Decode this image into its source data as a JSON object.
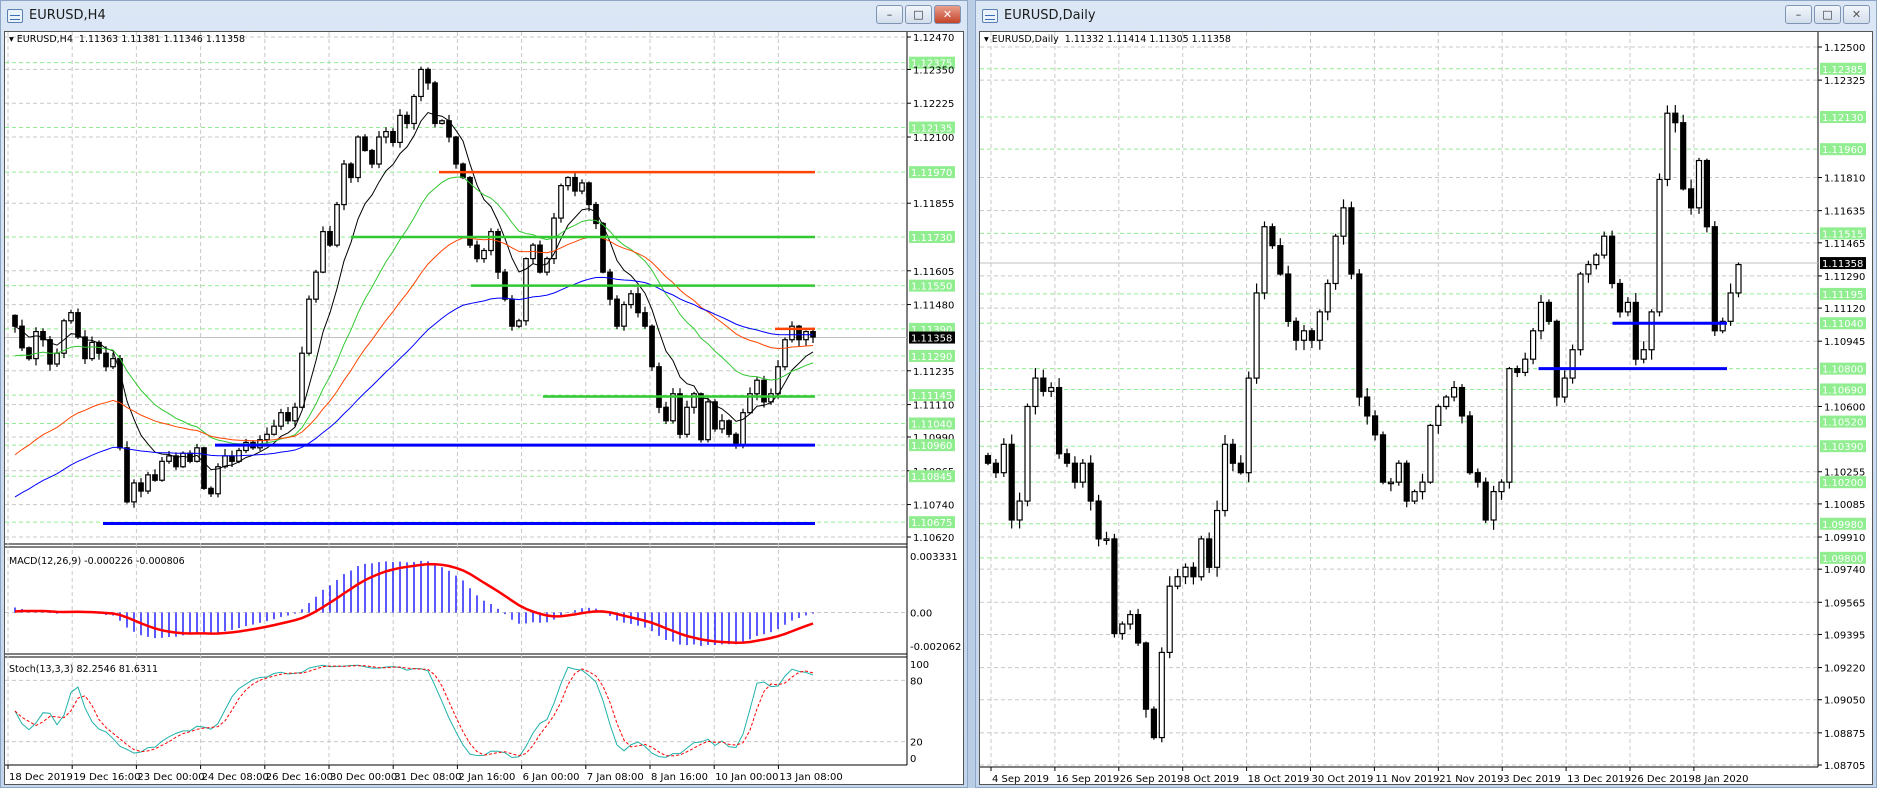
{
  "left_window": {
    "title": "EURUSD,H4",
    "info": "EURUSD,H4  1.11363 1.11381 1.11346 1.11358",
    "macd_label": "MACD(12,26,9) -0.000226 -0.000806",
    "stoch_label": "Stoch(13,3,3) 82.2546 81.6311",
    "buttons": {
      "minimize": "–",
      "maximize": "□",
      "close": "✕"
    }
  },
  "right_window": {
    "title": "EURUSD,Daily",
    "info": "EURUSD,Daily  1.11332 1.11414 1.11305 1.11358",
    "buttons": {
      "minimize": "–",
      "maximize": "□",
      "close": "✕"
    }
  },
  "colors": {
    "bull": "#ffffff",
    "bear": "#000000",
    "level_green": "#32c832",
    "level_orange": "#ff4500",
    "level_blue": "#0000ff",
    "label_green": "#90ee90",
    "macd_hist": "#0000ff",
    "macd_signal": "#ff0000",
    "stoch_main": "#20b2aa",
    "stoch_signal": "#ff0000"
  },
  "chart_data": [
    {
      "type": "candlestick",
      "title": "EURUSD,H4",
      "ylim": [
        1.1062,
        1.1247
      ],
      "x_tick_labels": [
        "18 Dec 2019",
        "19 Dec 16:00",
        "23 Dec 00:00",
        "24 Dec 08:00",
        "26 Dec 16:00",
        "30 Dec 00:00",
        "31 Dec 08:00",
        "2 Jan 16:00",
        "6 Jan 00:00",
        "7 Jan 08:00",
        "8 Jan 16:00",
        "10 Jan 00:00",
        "13 Jan 08:00"
      ],
      "closes": [
        1.114,
        1.1132,
        1.1128,
        1.1138,
        1.1135,
        1.1126,
        1.113,
        1.1142,
        1.1145,
        1.1136,
        1.1128,
        1.1134,
        1.113,
        1.1125,
        1.1128,
        1.1095,
        1.1075,
        1.1082,
        1.1079,
        1.1085,
        1.1083,
        1.109,
        1.1092,
        1.1088,
        1.1093,
        1.109,
        1.1095,
        1.108,
        1.1078,
        1.1088,
        1.1092,
        1.109,
        1.1094,
        1.1097,
        1.1095,
        1.1098,
        1.11,
        1.1103,
        1.1108,
        1.1105,
        1.111,
        1.113,
        1.115,
        1.116,
        1.1175,
        1.117,
        1.1185,
        1.12,
        1.1195,
        1.121,
        1.1205,
        1.12,
        1.121,
        1.1212,
        1.1208,
        1.1218,
        1.1215,
        1.1225,
        1.1235,
        1.123,
        1.1215,
        1.1216,
        1.121,
        1.12,
        1.1195,
        1.117,
        1.1165,
        1.1168,
        1.1175,
        1.116,
        1.115,
        1.114,
        1.1142,
        1.1165,
        1.117,
        1.116,
        1.1165,
        1.118,
        1.1192,
        1.1195,
        1.119,
        1.1193,
        1.1185,
        1.1178,
        1.116,
        1.115,
        1.114,
        1.1148,
        1.1152,
        1.1145,
        1.114,
        1.1125,
        1.111,
        1.1105,
        1.1115,
        1.11,
        1.111,
        1.1115,
        1.1098,
        1.1112,
        1.1102,
        1.1105,
        1.11,
        1.1096,
        1.1108,
        1.1115,
        1.112,
        1.1112,
        1.1115,
        1.1125,
        1.1135,
        1.114,
        1.1135,
        1.1138,
        1.1136
      ],
      "moving_averages": [
        {
          "color": "#000000",
          "period": 8,
          "start": 1.114
        },
        {
          "color": "#32c832",
          "period": 22,
          "start": 1.1128
        },
        {
          "color": "#ff4500",
          "period": 40,
          "start": 1.109
        },
        {
          "color": "#0000ff",
          "period": 70,
          "start": 1.1075
        }
      ],
      "levels": [
        {
          "price": 1.1197,
          "color": "orange",
          "from": 0.53
        },
        {
          "price": 1.1173,
          "color": "green",
          "from": 0.42
        },
        {
          "price": 1.1155,
          "color": "green",
          "from": 0.57
        },
        {
          "price": 1.1139,
          "color": "orange",
          "from": 0.95
        },
        {
          "price": 1.1114,
          "color": "green",
          "from": 0.66
        },
        {
          "price": 1.1096,
          "color": "blue",
          "from": 0.25
        },
        {
          "price": 1.1067,
          "color": "blue",
          "from": 0.11
        }
      ],
      "axis_labels": [
        {
          "v": 1.1247,
          "t": "1.12470"
        },
        {
          "v": 1.12375,
          "t": "1.12375",
          "g": 1
        },
        {
          "v": 1.1235,
          "t": "1.12350"
        },
        {
          "v": 1.12225,
          "t": "1.12225"
        },
        {
          "v": 1.12135,
          "t": "1.12135",
          "g": 1
        },
        {
          "v": 1.121,
          "t": "1.12100"
        },
        {
          "v": 1.1197,
          "t": "1.11970",
          "g": 1
        },
        {
          "v": 1.11855,
          "t": "1.11855"
        },
        {
          "v": 1.1173,
          "t": "1.11730",
          "g": 1
        },
        {
          "v": 1.11605,
          "t": "1.11605"
        },
        {
          "v": 1.1155,
          "t": "1.11550",
          "g": 1
        },
        {
          "v": 1.1148,
          "t": "1.11480"
        },
        {
          "v": 1.1139,
          "t": "1.11390",
          "g": 1
        },
        {
          "v": 1.11358,
          "t": "1.11358",
          "cur": 1
        },
        {
          "v": 1.1129,
          "t": "1.11290",
          "g": 1
        },
        {
          "v": 1.11235,
          "t": "1.11235"
        },
        {
          "v": 1.11145,
          "t": "1.11145",
          "g": 1
        },
        {
          "v": 1.1111,
          "t": "1.11110"
        },
        {
          "v": 1.1104,
          "t": "1.11040",
          "g": 1
        },
        {
          "v": 1.1099,
          "t": "1.10990"
        },
        {
          "v": 1.1096,
          "t": "1.10960",
          "g": 1
        },
        {
          "v": 1.10865,
          "t": "1.10865"
        },
        {
          "v": 1.10845,
          "t": "1.10845",
          "g": 1
        },
        {
          "v": 1.1074,
          "t": "1.10740"
        },
        {
          "v": 1.10675,
          "t": "1.10675",
          "g": 1
        },
        {
          "v": 1.1062,
          "t": "1.10620"
        }
      ],
      "macd_axis": [
        "0.003331",
        "0.00",
        "-0.002062"
      ],
      "macd_range": [
        -0.002062,
        0.003331
      ],
      "stoch_axis": [
        "100",
        "80",
        "20",
        "0"
      ]
    },
    {
      "type": "candlestick",
      "title": "EURUSD,Daily",
      "ylim": [
        1.08705,
        1.125
      ],
      "x_tick_labels": [
        "4 Sep 2019",
        "16 Sep 2019",
        "26 Sep 2019",
        "8 Oct 2019",
        "18 Oct 2019",
        "30 Oct 2019",
        "11 Nov 2019",
        "21 Nov 2019",
        "3 Dec 2019",
        "13 Dec 2019",
        "26 Dec 2019",
        "8 Jan 2020"
      ],
      "closes": [
        1.103,
        1.1025,
        1.104,
        1.1,
        1.101,
        1.106,
        1.1075,
        1.1068,
        1.107,
        1.1035,
        1.103,
        1.102,
        1.103,
        1.101,
        1.099,
        1.099,
        1.094,
        1.0945,
        1.095,
        1.0935,
        1.09,
        1.0885,
        1.093,
        1.0965,
        1.097,
        1.0975,
        1.097,
        1.099,
        1.0975,
        1.1005,
        1.104,
        1.103,
        1.1025,
        1.1075,
        1.112,
        1.1155,
        1.1145,
        1.113,
        1.1105,
        1.1095,
        1.11,
        1.1095,
        1.111,
        1.1125,
        1.115,
        1.1165,
        1.113,
        1.1065,
        1.1055,
        1.1045,
        1.102,
        1.102,
        1.103,
        1.101,
        1.1015,
        1.102,
        1.105,
        1.106,
        1.1065,
        1.107,
        1.1055,
        1.1025,
        1.102,
        1.1,
        1.1015,
        1.102,
        1.108,
        1.1078,
        1.1085,
        1.11,
        1.1115,
        1.1105,
        1.1065,
        1.1075,
        1.109,
        1.113,
        1.1135,
        1.114,
        1.115,
        1.1125,
        1.111,
        1.1115,
        1.1085,
        1.109,
        1.111,
        1.118,
        1.1215,
        1.121,
        1.1175,
        1.1165,
        1.119,
        1.1155,
        1.11,
        1.1105,
        1.112,
        1.1135
      ],
      "levels": [
        {
          "price": 1.1104,
          "color": "blue",
          "from": 0.845
        },
        {
          "price": 1.108,
          "color": "blue",
          "from": 0.745
        }
      ],
      "axis_labels": [
        {
          "v": 1.125,
          "t": "1.12500"
        },
        {
          "v": 1.12385,
          "t": "1.12385",
          "g": 1
        },
        {
          "v": 1.12325,
          "t": "1.12325"
        },
        {
          "v": 1.1213,
          "t": "1.12130",
          "g": 1
        },
        {
          "v": 1.1196,
          "t": "1.11960",
          "g": 1
        },
        {
          "v": 1.1181,
          "t": "1.11810"
        },
        {
          "v": 1.11635,
          "t": "1.11635"
        },
        {
          "v": 1.11515,
          "t": "1.11515",
          "g": 1
        },
        {
          "v": 1.11465,
          "t": "1.11465"
        },
        {
          "v": 1.11358,
          "t": "1.11358",
          "cur": 1
        },
        {
          "v": 1.1129,
          "t": "1.11290"
        },
        {
          "v": 1.11195,
          "t": "1.11195",
          "g": 1
        },
        {
          "v": 1.1112,
          "t": "1.11120"
        },
        {
          "v": 1.1104,
          "t": "1.11040",
          "g": 1
        },
        {
          "v": 1.10945,
          "t": "1.10945"
        },
        {
          "v": 1.108,
          "t": "1.10800",
          "g": 1
        },
        {
          "v": 1.1069,
          "t": "1.10690",
          "g": 1
        },
        {
          "v": 1.106,
          "t": "1.10600"
        },
        {
          "v": 1.1052,
          "t": "1.10520",
          "g": 1
        },
        {
          "v": 1.1039,
          "t": "1.10390",
          "g": 1
        },
        {
          "v": 1.10255,
          "t": "1.10255"
        },
        {
          "v": 1.102,
          "t": "1.10200",
          "g": 1
        },
        {
          "v": 1.10085,
          "t": "1.10085"
        },
        {
          "v": 1.0998,
          "t": "1.09980",
          "g": 1
        },
        {
          "v": 1.0991,
          "t": "1.09910"
        },
        {
          "v": 1.098,
          "t": "1.09800",
          "g": 1
        },
        {
          "v": 1.0974,
          "t": "1.09740"
        },
        {
          "v": 1.09565,
          "t": "1.09565"
        },
        {
          "v": 1.09395,
          "t": "1.09395"
        },
        {
          "v": 1.0922,
          "t": "1.09220"
        },
        {
          "v": 1.0905,
          "t": "1.09050"
        },
        {
          "v": 1.08875,
          "t": "1.08875"
        },
        {
          "v": 1.08705,
          "t": "1.08705"
        }
      ]
    }
  ]
}
